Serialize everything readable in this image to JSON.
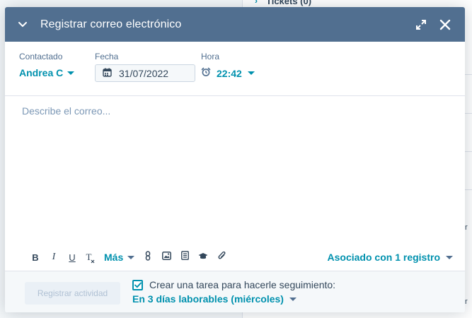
{
  "background": {
    "tickets_label": "Tickets (0)",
    "fragments": [
      "r",
      "r"
    ]
  },
  "dialog": {
    "title": "Registrar correo electrónico",
    "icons": {
      "collapse": "chevron-down-icon",
      "expand": "expand-icon",
      "close": "close-icon"
    }
  },
  "meta": {
    "contacted": {
      "label": "Contactado",
      "value": "Andrea C"
    },
    "date": {
      "label": "Fecha",
      "value": "31/07/2022"
    },
    "time": {
      "label": "Hora",
      "value": "22:42"
    }
  },
  "body": {
    "placeholder": "Describe el correo..."
  },
  "toolbar": {
    "bold": "B",
    "italic": "I",
    "underline": "U",
    "clear_format": "T",
    "more": "Más",
    "associated": "Asociado con 1 registro"
  },
  "footer": {
    "log_button": "Registrar actividad",
    "followup_label": "Crear una tarea para hacerle seguimiento:",
    "followup_checked": true,
    "followup_when": "En 3 días laborables (miércoles)"
  },
  "colors": {
    "header_bg": "#516f90",
    "accent": "#0091ae",
    "text": "#33475b",
    "muted": "#7c98b6"
  }
}
